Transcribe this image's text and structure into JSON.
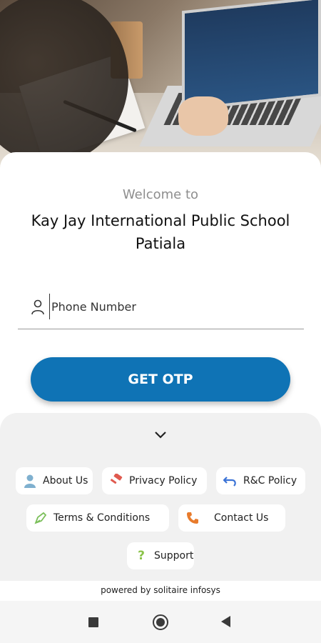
{
  "header": {
    "welcome": "Welcome to",
    "school_name": "Kay Jay International Public School Patiala"
  },
  "login": {
    "phone_placeholder": "Phone Number",
    "phone_value": "",
    "otp_button": "GET OTP"
  },
  "links": [
    {
      "label": "About Us",
      "icon": "person-icon"
    },
    {
      "label": "Privacy Policy",
      "icon": "gavel-icon"
    },
    {
      "label": "R&C Policy",
      "icon": "undo-icon"
    },
    {
      "label": "Terms & Conditions",
      "icon": "pen-icon"
    },
    {
      "label": "Contact Us",
      "icon": "phone-icon"
    },
    {
      "label": "Support",
      "icon": "question-icon"
    }
  ],
  "footer": {
    "powered": "powered by solitaire infosys"
  },
  "colors": {
    "primary": "#0f73b5",
    "panel": "#f1f1f1"
  }
}
